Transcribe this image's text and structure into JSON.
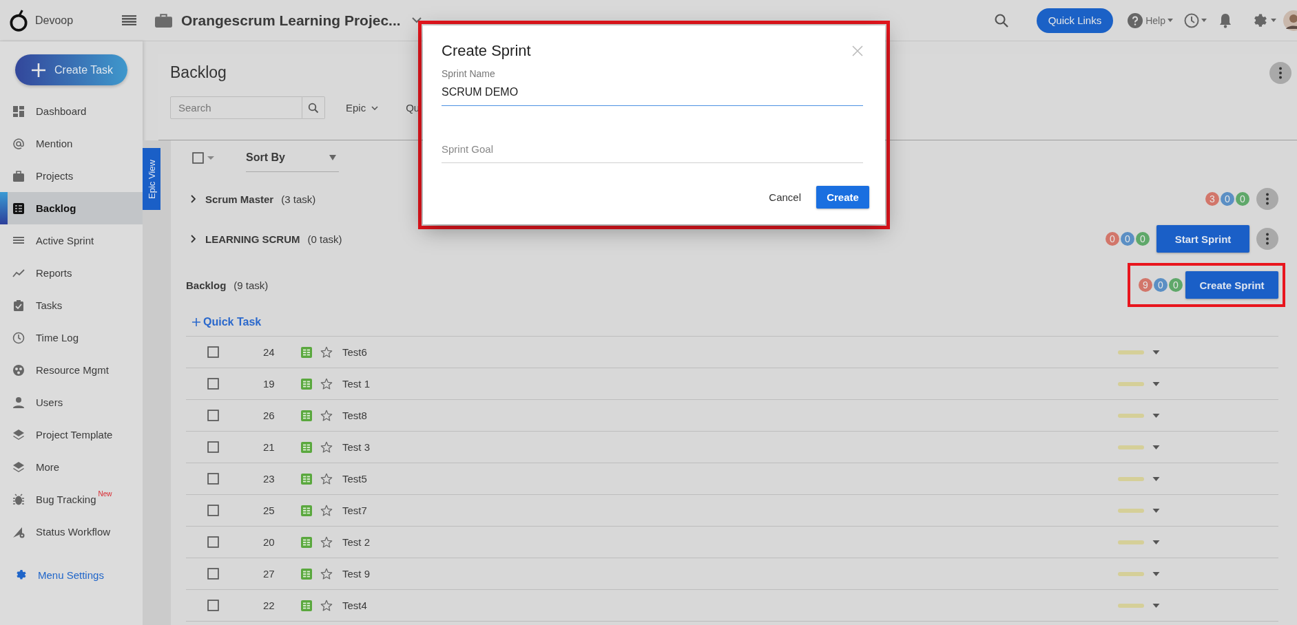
{
  "app": {
    "name": "Devoop"
  },
  "topbar": {
    "project": "Orangescrum Learning Projec...",
    "quick_links": "Quick Links",
    "help": "Help"
  },
  "sidebar": {
    "create_task": "Create Task",
    "items": [
      {
        "label": "Dashboard",
        "selected": false
      },
      {
        "label": "Mention",
        "selected": false
      },
      {
        "label": "Projects",
        "selected": false
      },
      {
        "label": "Backlog",
        "selected": true
      },
      {
        "label": "Active Sprint",
        "selected": false
      },
      {
        "label": "Reports",
        "selected": false
      },
      {
        "label": "Tasks",
        "selected": false
      },
      {
        "label": "Time Log",
        "selected": false
      },
      {
        "label": "Resource Mgmt",
        "selected": false
      },
      {
        "label": "Users",
        "selected": false
      },
      {
        "label": "Project Template",
        "selected": false
      },
      {
        "label": "More",
        "selected": false
      },
      {
        "label": "Bug Tracking",
        "selected": false,
        "badge": "New"
      },
      {
        "label": "Status Workflow",
        "selected": false
      }
    ],
    "menu_settings": "Menu Settings"
  },
  "page": {
    "title": "Backlog",
    "search_placeholder": "Search",
    "filters": [
      "Epic",
      "Qu"
    ],
    "epic_view": "Epic View",
    "sort_by": "Sort By",
    "select_all_checked": false
  },
  "sprints": [
    {
      "kind": "sprint",
      "name": "Scrum Master",
      "count": "(3 task)",
      "counts": [
        {
          "value": "3",
          "color": "#d2766a"
        },
        {
          "value": "0",
          "color": "#5b8fc4"
        },
        {
          "value": "0",
          "color": "#5fa86a"
        }
      ]
    },
    {
      "kind": "sprint",
      "name": "LEARNING SCRUM",
      "count": "(0 task)",
      "counts": [
        {
          "value": "0",
          "color": "#d2766a"
        },
        {
          "value": "0",
          "color": "#5b8fc4"
        },
        {
          "value": "0",
          "color": "#5fa86a"
        }
      ],
      "button": "Start Sprint"
    },
    {
      "kind": "backlog",
      "name": "Backlog",
      "count": "(9 task)",
      "counts": [
        {
          "value": "9",
          "color": "#d2766a"
        },
        {
          "value": "0",
          "color": "#5b8fc4"
        },
        {
          "value": "0",
          "color": "#5fa86a"
        }
      ],
      "button": "Create Sprint",
      "highlighted": true
    }
  ],
  "quick_task": "Quick Task",
  "tasks": [
    {
      "id": "24",
      "title": "Test6",
      "checked": false,
      "starred": false
    },
    {
      "id": "19",
      "title": "Test 1",
      "checked": false,
      "starred": false
    },
    {
      "id": "26",
      "title": "Test8",
      "checked": false,
      "starred": false
    },
    {
      "id": "21",
      "title": "Test 3",
      "checked": false,
      "starred": false
    },
    {
      "id": "23",
      "title": "Test5",
      "checked": false,
      "starred": false
    },
    {
      "id": "25",
      "title": "Test7",
      "checked": false,
      "starred": false
    },
    {
      "id": "20",
      "title": "Test 2",
      "checked": false,
      "starred": false
    },
    {
      "id": "27",
      "title": "Test 9",
      "checked": false,
      "starred": false
    },
    {
      "id": "22",
      "title": "Test4",
      "checked": false,
      "starred": false
    }
  ],
  "modal": {
    "title": "Create Sprint",
    "highlighted": true,
    "fields": [
      {
        "label": "Sprint Name",
        "value": "SCRUM DEMO",
        "focused": true
      },
      {
        "placeholder": "Sprint Goal",
        "focused": false
      }
    ],
    "cancel": "Cancel",
    "create": "Create"
  }
}
